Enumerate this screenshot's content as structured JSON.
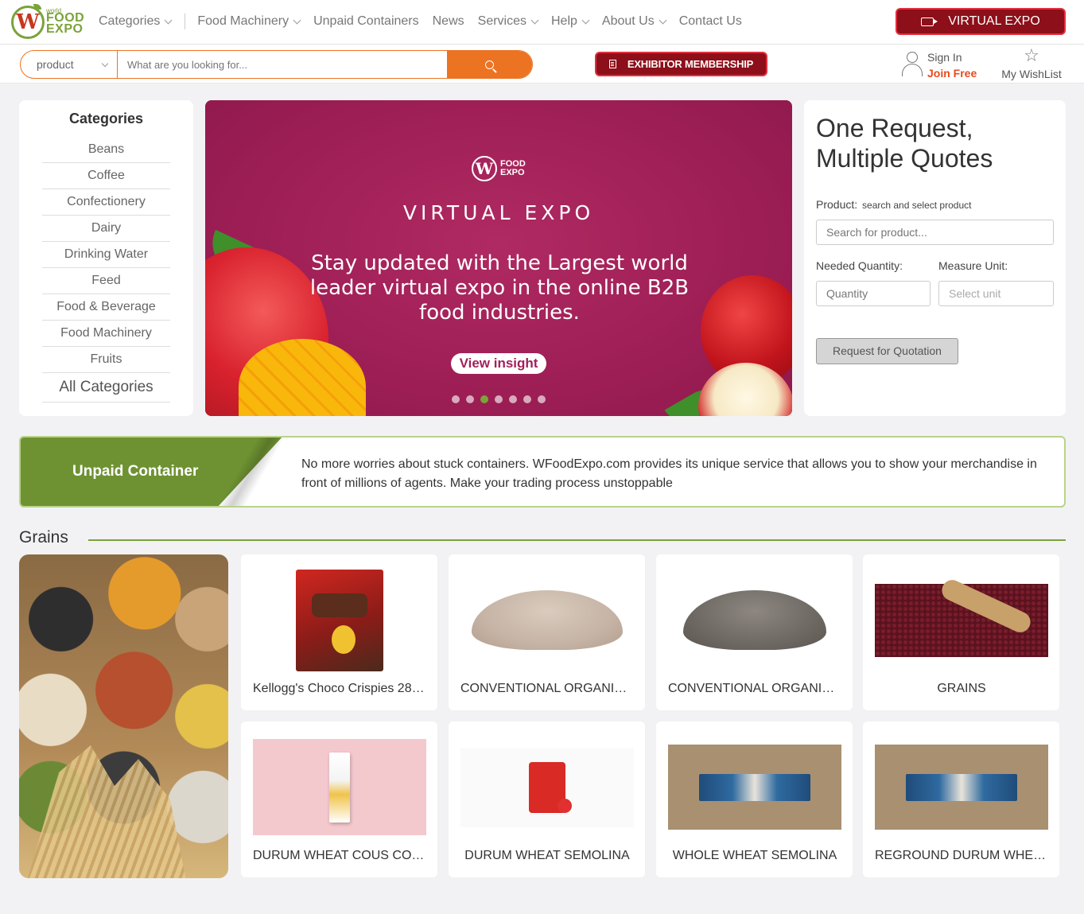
{
  "header": {
    "logo": {
      "top": "world",
      "line1": "FOOD",
      "line2": "EXPO",
      "mark": "W"
    },
    "nav": [
      {
        "label": "Categories",
        "dropdown": true
      },
      {
        "label": "Food Machinery",
        "dropdown": true
      },
      {
        "label": "Unpaid Containers",
        "dropdown": false
      },
      {
        "label": "News",
        "dropdown": false
      },
      {
        "label": "Services",
        "dropdown": true
      },
      {
        "label": "Help",
        "dropdown": true
      },
      {
        "label": "About Us",
        "dropdown": true
      },
      {
        "label": "Contact Us",
        "dropdown": false
      }
    ],
    "virtual_expo_label": "VIRTUAL EXPO"
  },
  "search": {
    "type_selected": "product",
    "placeholder": "What are you looking for...",
    "membership_label": "EXHIBITOR MEMBERSHIP",
    "sign_in": "Sign In",
    "join_free": "Join Free",
    "wishlist": "My WishList"
  },
  "categories": {
    "title": "Categories",
    "items": [
      "Beans",
      "Coffee",
      "Confectionery",
      "Dairy",
      "Drinking Water",
      "Feed",
      "Food & Beverage",
      "Food Machinery",
      "Fruits"
    ],
    "all_label": "All Categories"
  },
  "banner": {
    "logo_mark": "W",
    "logo_text_1": "FOOD",
    "logo_text_2": "EXPO",
    "title": "VIRTUAL EXPO",
    "text": "Stay updated with the Largest world leader virtual expo in the online B2B food industries.",
    "button": "View insight",
    "slide_count": 7,
    "active_slide": 3
  },
  "quote": {
    "title": "One Request, Multiple Quotes",
    "product_label": "Product:",
    "product_hint": "search and select product",
    "product_placeholder": "Search for product...",
    "quantity_label": "Needed Quantity:",
    "quantity_placeholder": "Quantity",
    "unit_label": "Measure Unit:",
    "unit_placeholder": "Select unit",
    "button": "Request for Quotation"
  },
  "unpaid": {
    "title": "Unpaid Container",
    "text": "No more worries about stuck containers. WFoodExpo.com provides its unique service that allows you to show your merchandise in front of millions of agents. Make your trading process unstoppable"
  },
  "grains": {
    "title": "Grains",
    "products": [
      {
        "title": "Kellogg's Choco Crispies 28…",
        "image": "cereal-box"
      },
      {
        "title": "CONVENTIONAL ORGANI…",
        "image": "flour-pile-light"
      },
      {
        "title": "CONVENTIONAL ORGANI…",
        "image": "seed-pile-dark"
      },
      {
        "title": "GRAINS",
        "image": "red-beans-scoop"
      },
      {
        "title": "DURUM WHEAT COUS CO…",
        "image": "sachet-pink"
      },
      {
        "title": "DURUM WHEAT SEMOLINA",
        "image": "pizza-pack"
      },
      {
        "title": "WHOLE WHEAT SEMOLINA",
        "image": "pasta-kraft"
      },
      {
        "title": "REGROUND DURUM WHE…",
        "image": "pasta-kraft"
      }
    ]
  },
  "colors": {
    "brand_green": "#7aa33a",
    "brand_orange": "#ec7322",
    "brand_red": "#8d0f19",
    "banner_magenta": "#a3215a"
  }
}
